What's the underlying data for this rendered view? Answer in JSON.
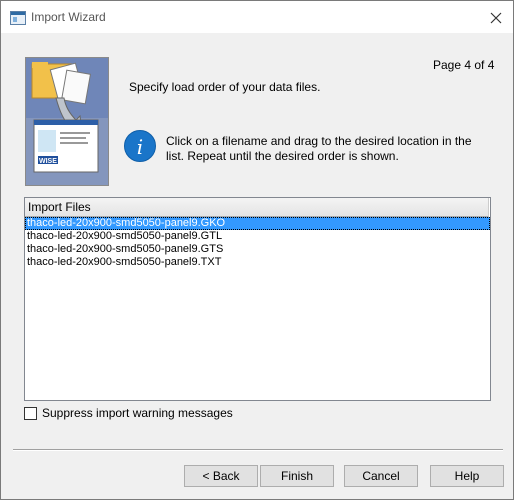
{
  "window": {
    "title": "Import Wizard",
    "close_label": "✕"
  },
  "wizard": {
    "page_indicator": "Page 4 of 4",
    "heading": "Specify load order of your data files.",
    "instructions": "Click on a filename and drag to the desired location in the list. Repeat until the desired order is shown.",
    "art_logo_text": "WISE"
  },
  "file_list": {
    "header": "Import Files",
    "items": [
      {
        "label": "thaco-led-20x900-smd5050-panel9.GKO",
        "selected": true
      },
      {
        "label": "thaco-led-20x900-smd5050-panel9.GTL",
        "selected": false
      },
      {
        "label": "thaco-led-20x900-smd5050-panel9.GTS",
        "selected": false
      },
      {
        "label": "thaco-led-20x900-smd5050-panel9.TXT",
        "selected": false
      }
    ]
  },
  "options": {
    "suppress_label": "Suppress import warning messages",
    "suppress_checked": false
  },
  "buttons": {
    "back": "< Back",
    "finish": "Finish",
    "cancel": "Cancel",
    "help": "Help"
  },
  "colors": {
    "selection": "#3399ff",
    "info_icon": "#1a75c9"
  }
}
